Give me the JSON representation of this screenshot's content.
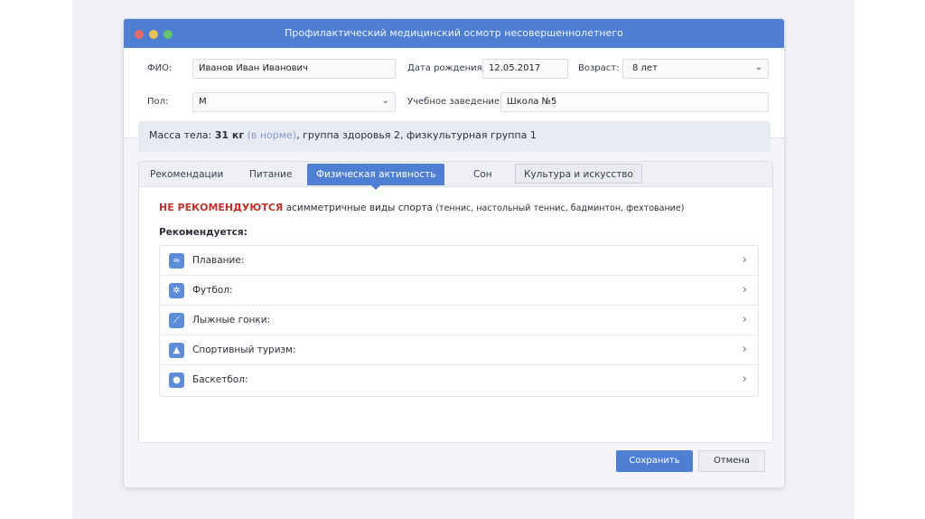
{
  "window": {
    "title": "Профилактический медицинский осмотр несовершеннолетнего"
  },
  "form": {
    "fio_label": "ФИО:",
    "fio_value": "Иванов Иван Иванович",
    "dob_label": "Дата рождения:",
    "dob_value": "12.05.2017",
    "age_label": "Возраст:",
    "age_value": "8 лет",
    "sex_label": "Пол:",
    "sex_value": "М",
    "school_label": "Учебное заведение:",
    "school_value": "Школа №5"
  },
  "summary": {
    "mass_label": "Масса тела:",
    "mass_value": "31 кг",
    "norm": "(в норме)",
    "rest": ", группа здоровья 2, физкультурная группа 1"
  },
  "tabs": [
    "Рекомендации",
    "Питание",
    "Физическая активность",
    "Сон",
    "Культура и искусство"
  ],
  "content": {
    "warn_caps": "НЕ РЕКОМЕНДУЮТСЯ",
    "warn_text": "асимметричные виды спорта",
    "warn_details": "(теннис, настольный теннис,  бадминтон, фехтование)",
    "recommended_label": "Рекомендуется:",
    "items": [
      {
        "label": "Плавание:",
        "icon": "swimming-icon"
      },
      {
        "label": "Футбол:",
        "icon": "football-icon"
      },
      {
        "label": "Лыжные гонки:",
        "icon": "skiing-icon"
      },
      {
        "label": "Спортивный туризм:",
        "icon": "hiking-icon"
      },
      {
        "label": "Баскетбол:",
        "icon": "basketball-icon"
      }
    ]
  },
  "buttons": {
    "save": "Сохранить",
    "cancel": "Отмена"
  },
  "colors": {
    "accent": "#4e7fd2",
    "warning": "#c0322b"
  }
}
